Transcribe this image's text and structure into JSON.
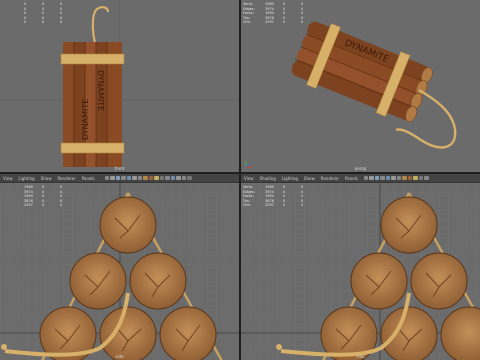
{
  "viewports": [
    {
      "id": "front",
      "hud_rows": [
        {
          "label": "",
          "c1": "0",
          "c2": "0",
          "c3": "0"
        },
        {
          "label": "",
          "c1": "0",
          "c2": "0",
          "c3": "0"
        },
        {
          "label": "",
          "c1": "0",
          "c2": "0",
          "c3": "0"
        },
        {
          "label": "",
          "c1": "0",
          "c2": "0",
          "c3": "0"
        },
        {
          "label": "",
          "c1": "0",
          "c2": "0",
          "c3": "0"
        }
      ],
      "camera_label": "front"
    },
    {
      "id": "persp",
      "hud_rows": [
        {
          "label": "Verts:",
          "c1": "1980",
          "c2": "0",
          "c3": "0"
        },
        {
          "label": "Edges:",
          "c1": "3974",
          "c2": "0",
          "c3": "0"
        },
        {
          "label": "Faces:",
          "c1": "1994",
          "c2": "0",
          "c3": "0"
        },
        {
          "label": "Tris:",
          "c1": "3876",
          "c2": "0",
          "c3": "0"
        },
        {
          "label": "UVs:",
          "c1": "2097",
          "c2": "0",
          "c3": "0"
        }
      ],
      "camera_label": "persp"
    },
    {
      "id": "side-left",
      "menu": [
        "View",
        "Lighting",
        "Show",
        "Renderer",
        "Panels"
      ],
      "hud_rows": [
        {
          "label": "",
          "c1": "1980",
          "c2": "0",
          "c3": "0"
        },
        {
          "label": "",
          "c1": "3974",
          "c2": "0",
          "c3": "0"
        },
        {
          "label": "",
          "c1": "1994",
          "c2": "0",
          "c3": "0"
        },
        {
          "label": "",
          "c1": "3876",
          "c2": "0",
          "c3": "0"
        },
        {
          "label": "",
          "c1": "2097",
          "c2": "0",
          "c3": "0"
        }
      ],
      "camera_label": "side"
    },
    {
      "id": "side-right",
      "menu": [
        "View",
        "Shading",
        "Lighting",
        "Show",
        "Renderer",
        "Panels"
      ],
      "hud_rows": [
        {
          "label": "Verts:",
          "c1": "1980",
          "c2": "0",
          "c3": "0"
        },
        {
          "label": "Edges:",
          "c1": "3974",
          "c2": "0",
          "c3": "0"
        },
        {
          "label": "Faces:",
          "c1": "1994",
          "c2": "0",
          "c3": "0"
        },
        {
          "label": "Tris:",
          "c1": "3876",
          "c2": "0",
          "c3": "0"
        },
        {
          "label": "UVs:",
          "c1": "2097",
          "c2": "0",
          "c3": "0"
        }
      ],
      "camera_label": "side"
    }
  ],
  "model": {
    "label_text": "DYNAMITE",
    "colors": {
      "stick": "#8a4a24",
      "stick_dark": "#5b2e14",
      "rope": "#d7b06a",
      "rope_dark": "#a8823e",
      "end_cap": "#b07a45",
      "end_cap_dark": "#7a4a24",
      "grid": "#7a7a7a",
      "grid_dark": "#5f5f5f"
    }
  },
  "toolbar_icons": [
    "select-icon",
    "move-icon",
    "rotate-icon",
    "scale-icon",
    "camera-icon",
    "grid-icon",
    "wireframe-icon",
    "shaded-icon",
    "textured-icon",
    "light-icon",
    "shadow-icon",
    "isolate-icon",
    "xray-icon",
    "resolution-icon",
    "film-gate-icon",
    "safe-action-icon"
  ]
}
